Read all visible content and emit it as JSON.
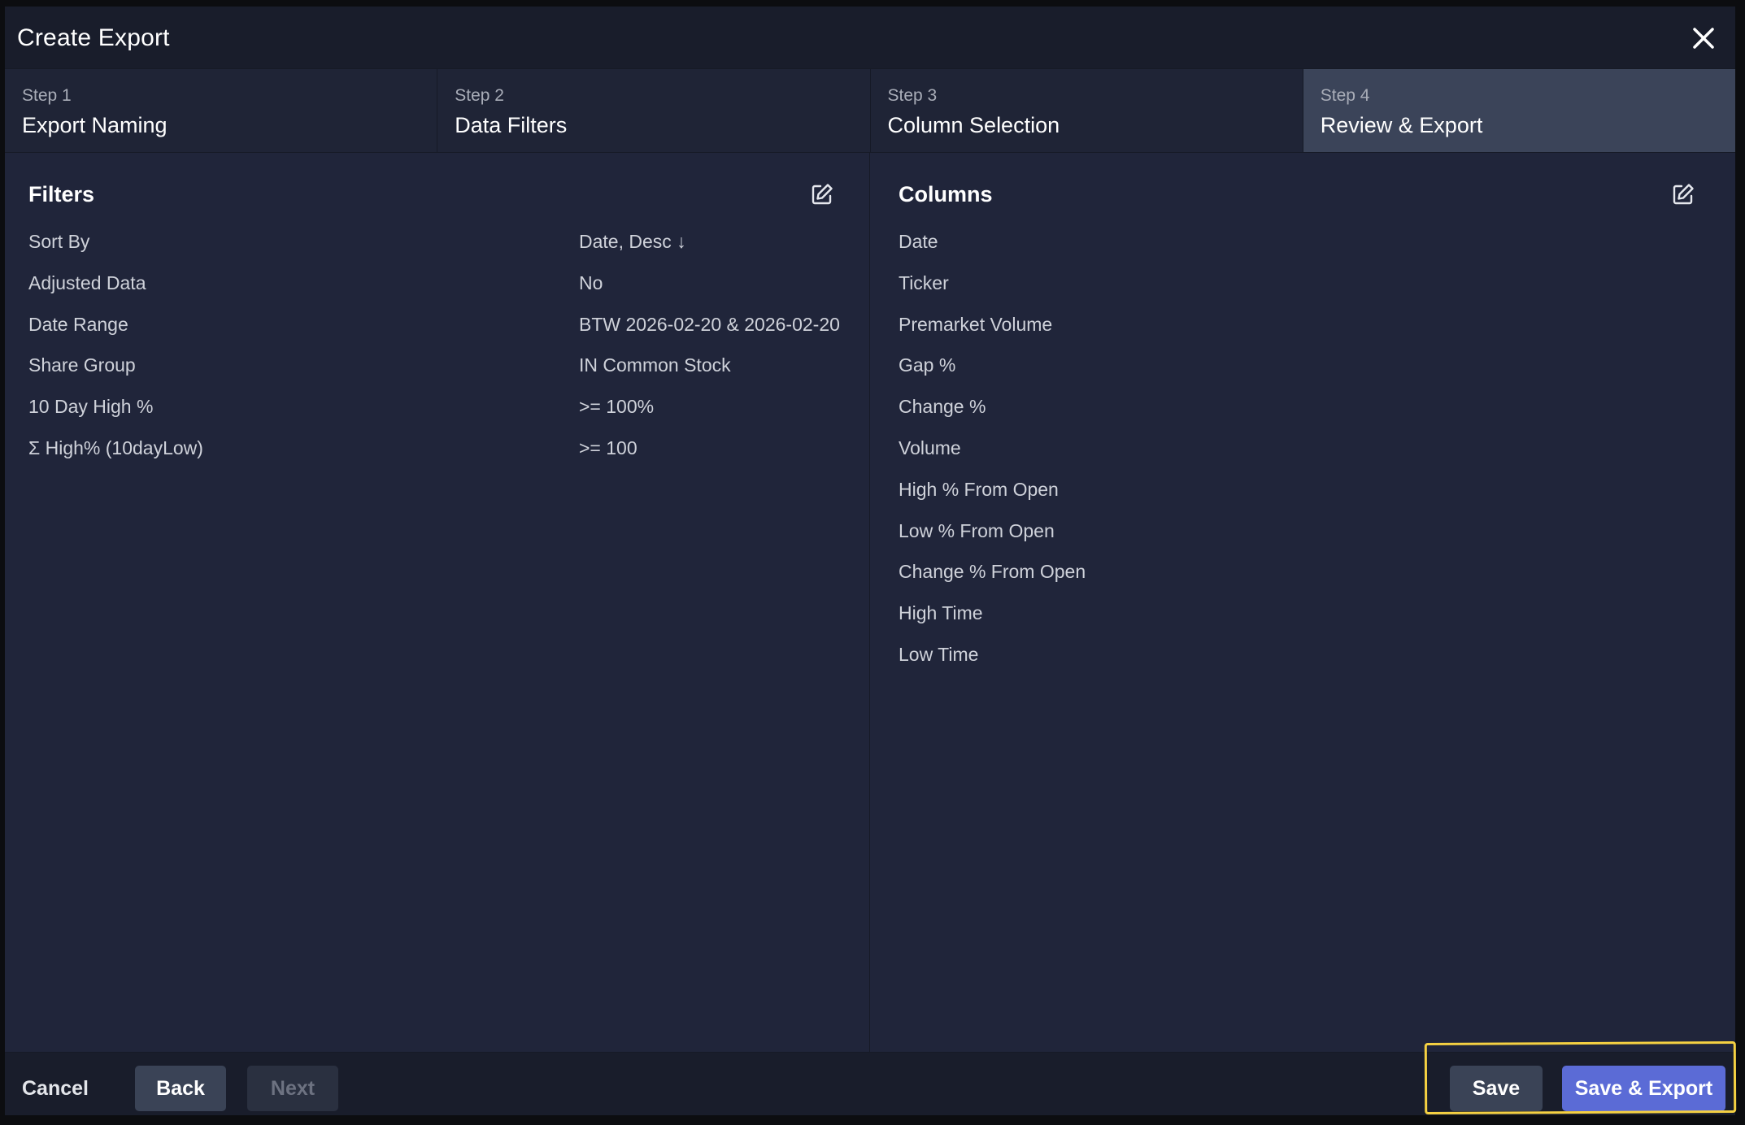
{
  "dialog": {
    "title": "Create Export"
  },
  "steps": [
    {
      "number": "Step 1",
      "name": "Export Naming",
      "active": false
    },
    {
      "number": "Step 2",
      "name": "Data Filters",
      "active": false
    },
    {
      "number": "Step 3",
      "name": "Column Selection",
      "active": false
    },
    {
      "number": "Step 4",
      "name": "Review & Export",
      "active": true
    }
  ],
  "filters": {
    "title": "Filters",
    "rows": [
      {
        "label": "Sort By",
        "value": "Date, Desc ↓"
      },
      {
        "label": "Adjusted Data",
        "value": "No"
      },
      {
        "label": "Date Range",
        "value": "BTW 2026-02-20 & 2026-02-20"
      },
      {
        "label": "Share Group",
        "value": "IN Common Stock"
      },
      {
        "label": "10 Day High %",
        "value": ">= 100%"
      },
      {
        "label": "Σ High% (10dayLow)",
        "value": ">= 100"
      }
    ]
  },
  "columns": {
    "title": "Columns",
    "items": [
      "Date",
      "Ticker",
      "Premarket Volume",
      "Gap %",
      "Change %",
      "Volume",
      "High % From Open",
      "Low % From Open",
      "Change % From Open",
      "High Time",
      "Low Time"
    ]
  },
  "footer": {
    "cancel": "Cancel",
    "back": "Back",
    "next": "Next",
    "save": "Save",
    "save_export": "Save & Export"
  },
  "colors": {
    "accent": "#5b6bd6",
    "highlight": "#f5d142"
  }
}
